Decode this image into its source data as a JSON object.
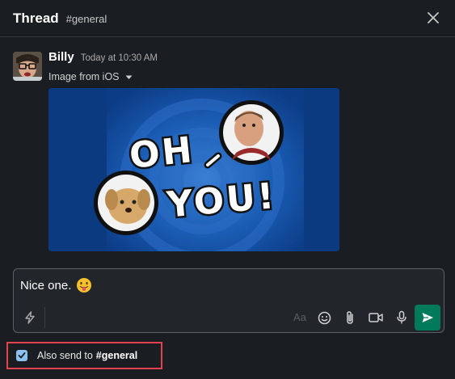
{
  "header": {
    "title": "Thread",
    "channel": "#general"
  },
  "message": {
    "author": "Billy",
    "timestamp": "Today at 10:30 AM",
    "attachment_label": "Image from iOS",
    "image_text_line1": "OH",
    "image_text_line2": "YOU!"
  },
  "composer": {
    "text": "Nice one.",
    "format_label": "Aa"
  },
  "also_send": {
    "checked": true,
    "label": "Also send to",
    "channel": "#general"
  },
  "colors": {
    "background": "#1a1d21",
    "send_button": "#007a5a",
    "highlight_border": "#e4434b",
    "checkbox": "#8bc0f0"
  },
  "icons": {
    "close": "close-icon",
    "caret": "caret-down-icon",
    "shortcuts": "lightning-icon",
    "emoji": "emoji-icon",
    "attach": "paperclip-icon",
    "video": "video-icon",
    "audio": "microphone-icon",
    "send": "send-icon"
  }
}
